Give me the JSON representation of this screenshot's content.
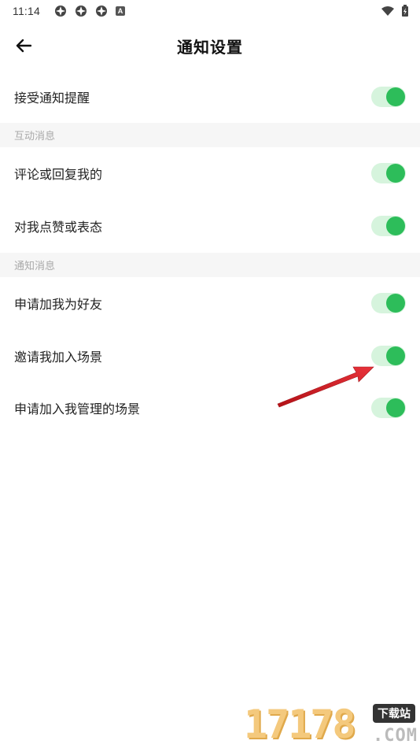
{
  "status_bar": {
    "time": "11:14",
    "notif_badge": "A"
  },
  "header": {
    "title": "通知设置"
  },
  "rows": {
    "receive": "接受通知提醒",
    "comment": "评论或回复我的",
    "like": "对我点赞或表态",
    "friend": "申请加我为好友",
    "invite": "邀请我加入场景",
    "join_managed": "申请加入我管理的场景"
  },
  "sections": {
    "interaction": "互动消息",
    "notification": "通知消息"
  },
  "toggles": {
    "receive": true,
    "comment": true,
    "like": true,
    "friend": true,
    "invite": true,
    "join_managed": true
  },
  "colors": {
    "toggle_on_track": "#d6f4dd",
    "toggle_on_knob": "#2dbd5a",
    "annotation_arrow": "#d9242b"
  },
  "watermark": {
    "digits": "17178",
    "badge": "下载站",
    "domain": ".COM"
  }
}
